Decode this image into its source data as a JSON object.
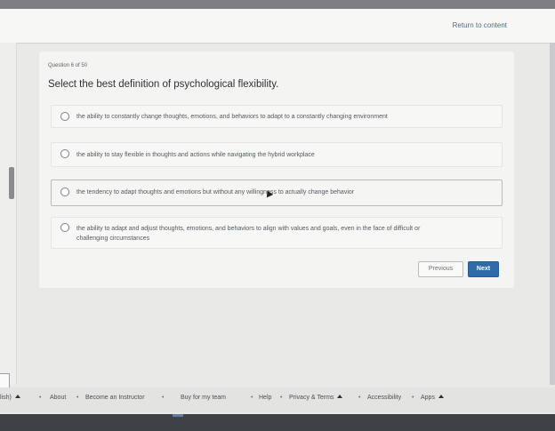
{
  "header": {
    "return_link": "Return to content"
  },
  "question": {
    "number_label": "Question 6 of 50",
    "prompt": "Select the best definition of psychological flexibility."
  },
  "options": [
    {
      "label": "the ability to constantly change thoughts, emotions, and behaviors to adapt to a constantly changing environment",
      "selected": false
    },
    {
      "label": "the ability to stay flexible in thoughts and actions while navigating the hybrid workplace",
      "selected": false
    },
    {
      "label": "the tendency to adapt thoughts and emotions but without any willingness to actually change behavior",
      "selected": false
    },
    {
      "label": "the ability to adapt and adjust thoughts, emotions, and behaviors to align with values and goals, even in the face of difficult or",
      "label_line2": "challenging circumstances",
      "selected": false
    }
  ],
  "navigation": {
    "previous_label": "Previous",
    "next_label": "Next"
  },
  "footer": {
    "language_fragment": "lish)",
    "links": [
      "About",
      "Become an Instructor",
      "Buy for my team",
      "Help",
      "Privacy & Terms",
      "Accessibility",
      "Apps"
    ]
  },
  "colors": {
    "accent": "#2e6ba7",
    "link": "#4f6f7e"
  }
}
